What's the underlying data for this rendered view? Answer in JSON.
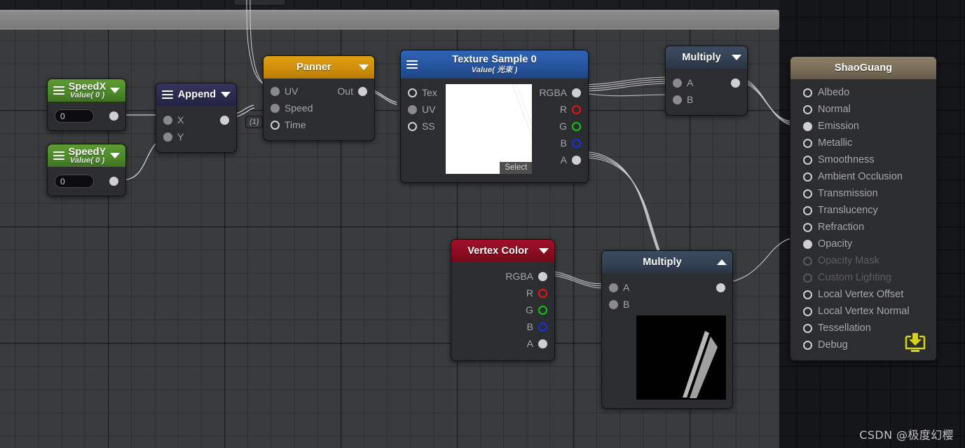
{
  "app": {
    "watermark": "CSDN @极度幻樱"
  },
  "canvas": {
    "mini_tab_label": "(1)"
  },
  "nodes": {
    "speed_x": {
      "title": "SpeedX",
      "subtitle": "Value( 0 )",
      "value": "0",
      "menu_icon": "hamburger-icon",
      "collapse_icon": "chevron-down-icon",
      "header_color": "#4e8a2a"
    },
    "speed_y": {
      "title": "SpeedY",
      "subtitle": "Value( 0 )",
      "value": "0",
      "menu_icon": "hamburger-icon",
      "collapse_icon": "chevron-down-icon",
      "header_color": "#4e8a2a"
    },
    "append": {
      "title": "Append",
      "menu_icon": "hamburger-icon",
      "collapse_icon": "chevron-down-icon",
      "header_color": "#2b2b50",
      "inputs": [
        "X",
        "Y"
      ]
    },
    "panner": {
      "title": "Panner",
      "collapse_icon": "chevron-down-icon",
      "header_color": "#cf8f0c",
      "inputs": [
        "UV",
        "Speed",
        "Time"
      ],
      "output": "Out"
    },
    "texture_sample": {
      "title": "Texture Sample 0",
      "subtitle": "Value( 光束 )",
      "menu_icon": "hamburger-icon",
      "header_color": "#27559f",
      "inputs": [
        "Tex",
        "UV",
        "SS"
      ],
      "outputs": [
        "RGBA",
        "R",
        "G",
        "B",
        "A"
      ],
      "select_label": "Select"
    },
    "vertex_color": {
      "title": "Vertex Color",
      "collapse_icon": "chevron-down-icon",
      "header_color": "#8c0c21",
      "outputs": [
        "RGBA",
        "R",
        "G",
        "B",
        "A"
      ]
    },
    "multiply_top": {
      "title": "Multiply",
      "collapse_icon": "chevron-down-icon",
      "header_color": "#334154",
      "inputs": [
        "A",
        "B"
      ]
    },
    "multiply_bottom": {
      "title": "Multiply",
      "collapse_icon": "chevron-up-icon",
      "header_color": "#334154",
      "inputs": [
        "A",
        "B"
      ]
    },
    "master": {
      "title": "ShaoGuang",
      "header_color": "#7a6e59",
      "save_icon": "save-download-icon",
      "ports": [
        {
          "label": "Albedo",
          "state": "empty"
        },
        {
          "label": "Normal",
          "state": "empty"
        },
        {
          "label": "Emission",
          "state": "connected"
        },
        {
          "label": "Metallic",
          "state": "empty"
        },
        {
          "label": "Smoothness",
          "state": "empty"
        },
        {
          "label": "Ambient Occlusion",
          "state": "empty"
        },
        {
          "label": "Transmission",
          "state": "empty"
        },
        {
          "label": "Translucency",
          "state": "empty"
        },
        {
          "label": "Refraction",
          "state": "empty"
        },
        {
          "label": "Opacity",
          "state": "connected"
        },
        {
          "label": "Opacity Mask",
          "state": "disabled"
        },
        {
          "label": "Custom Lighting",
          "state": "disabled"
        },
        {
          "label": "Local Vertex Offset",
          "state": "empty"
        },
        {
          "label": "Local Vertex Normal",
          "state": "empty"
        },
        {
          "label": "Tessellation",
          "state": "empty"
        },
        {
          "label": "Debug",
          "state": "empty"
        }
      ]
    }
  }
}
